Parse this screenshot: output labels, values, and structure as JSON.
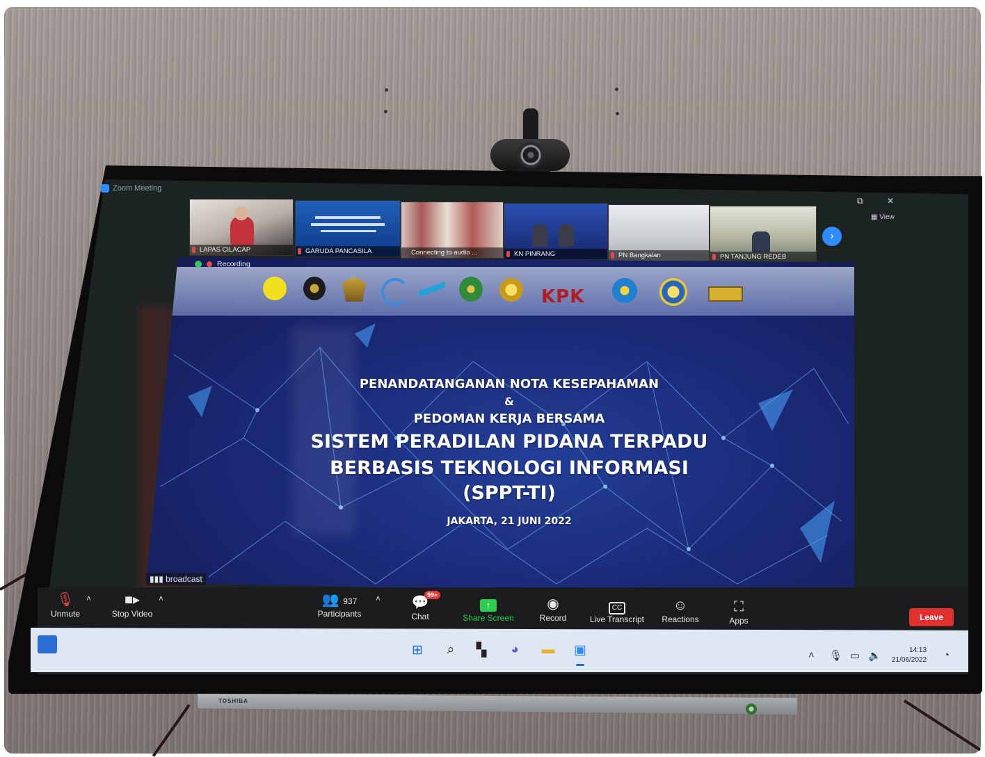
{
  "zoom": {
    "window_title": "Zoom Meeting",
    "view_label": "View",
    "recording_label": "Recording",
    "broadcast_label": "broadcast",
    "participants": [
      {
        "name": "LAPAS CILACAP"
      },
      {
        "name": "GARUDA PANCASILA"
      },
      {
        "name": "Connecting to audio ..."
      },
      {
        "name": "KN PINRANG"
      },
      {
        "name": "PN Bangkalan"
      },
      {
        "name": "PN TANJUNG REDEB"
      }
    ],
    "toolbar": {
      "unmute": "Unmute",
      "stop_video": "Stop Video",
      "participants_count": "937",
      "participants": "Participants",
      "chat_badge": "99+",
      "chat": "Chat",
      "share_screen": "Share Screen",
      "record": "Record",
      "live_transcript": "Live Transcript",
      "reactions": "Reactions",
      "apps": "Apps",
      "leave": "Leave"
    }
  },
  "slide": {
    "logo_kpk": "KPK",
    "line1": "PENANDATANGANAN NOTA KESEPAHAMAN",
    "ampersand": "&",
    "line2": "PEDOMAN KERJA BERSAMA",
    "title1": "SISTEM PERADILAN PIDANA TERPADU",
    "title2": "BERBASIS TEKNOLOGI INFORMASI",
    "title3": "(SPPT-TI)",
    "date_place": "JAKARTA, 21 JUNI 2022"
  },
  "taskbar": {
    "time": "14:13",
    "date": "21/06/2022",
    "apps": [
      "start-icon",
      "search-icon",
      "task-view-icon",
      "teams-chat-icon",
      "file-explorer-icon",
      "zoom-icon"
    ]
  },
  "tv": {
    "brand": "TOSHIBA"
  },
  "colors": {
    "zoom_blue": "#2d8cff",
    "share_green": "#2ecc4f",
    "leave_red": "#e0312e",
    "slide_blue": "#1b2a78"
  }
}
